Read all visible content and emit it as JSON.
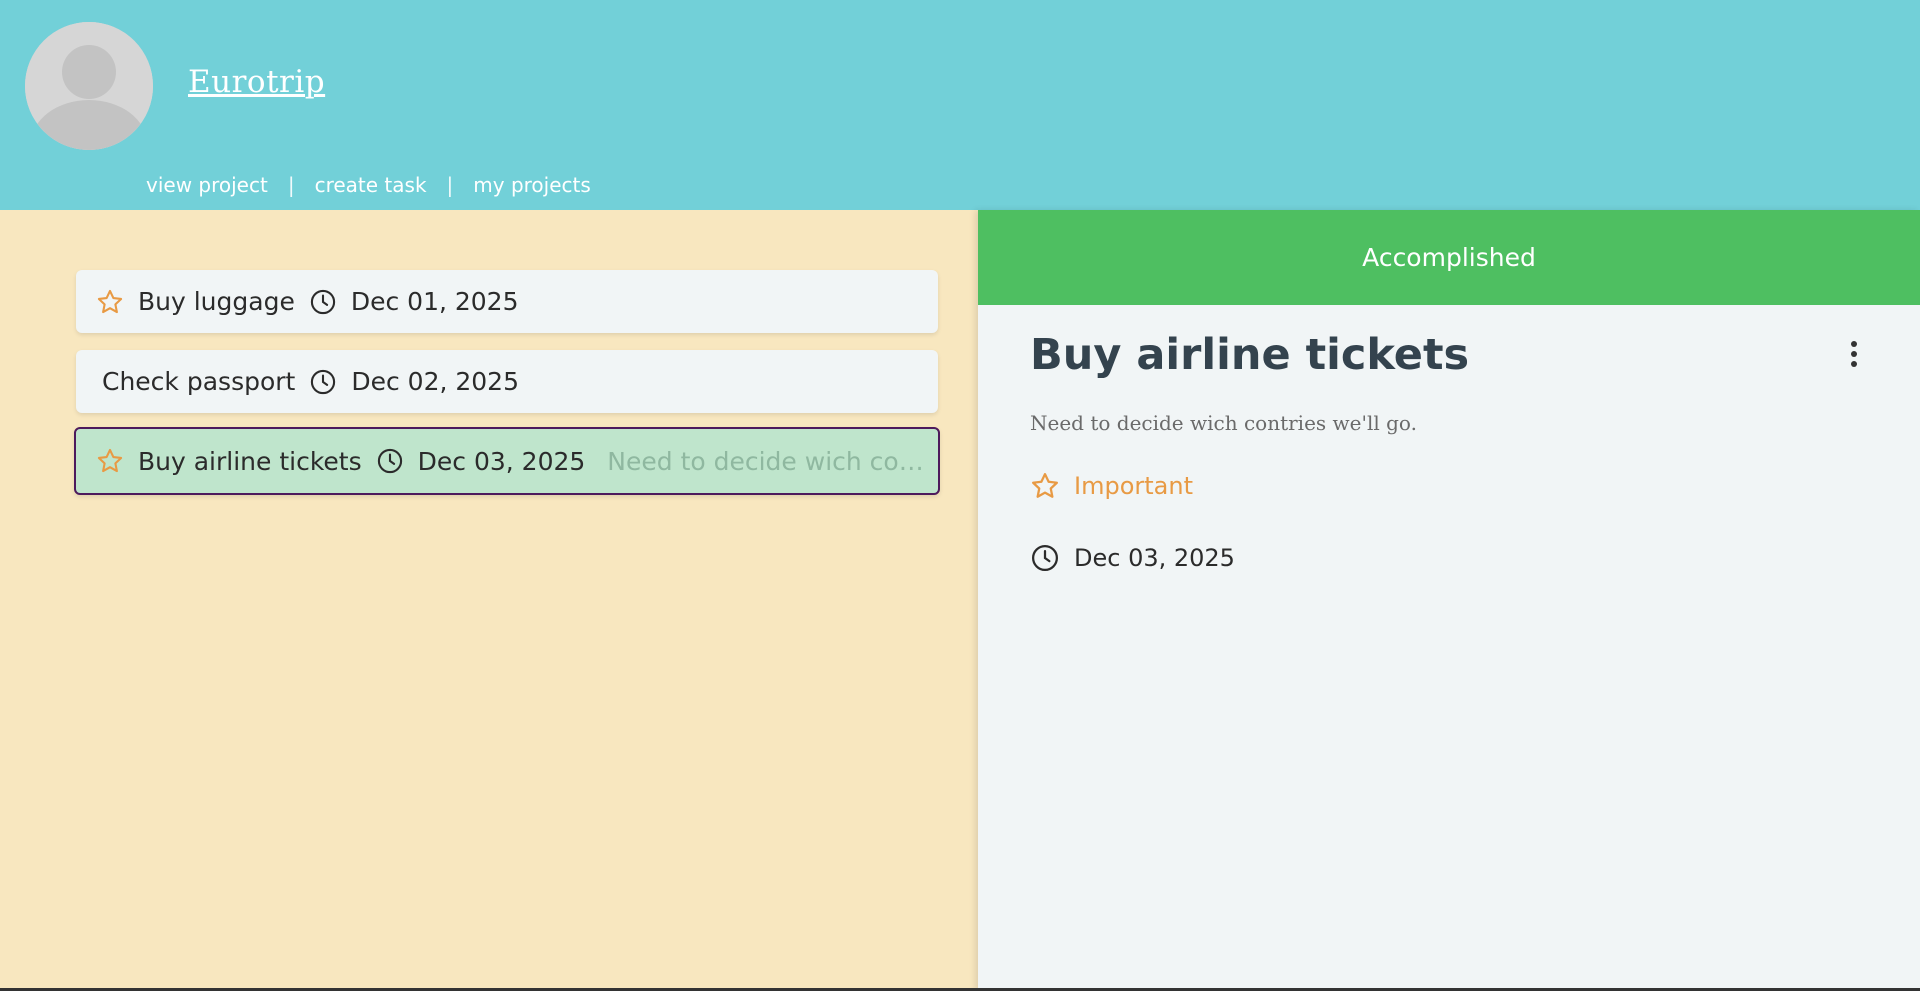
{
  "header": {
    "project_title": "Eurotrip",
    "nav": [
      {
        "label": "view project"
      },
      {
        "label": "create task"
      },
      {
        "label": "my projects"
      }
    ],
    "separator": "|"
  },
  "tasks": [
    {
      "title": "Buy luggage",
      "date": "Dec 01, 2025",
      "important": true,
      "description": ""
    },
    {
      "title": "Check passport",
      "date": "Dec 02, 2025",
      "important": false,
      "description": ""
    },
    {
      "title": "Buy airline tickets",
      "date": "Dec 03, 2025",
      "important": true,
      "description": "Need to decide wich contries ...",
      "selected": true
    }
  ],
  "detail": {
    "status": "Accomplished",
    "title": "Buy airline tickets",
    "description": "Need to decide wich contries we'll go.",
    "priority": "Important",
    "date": "Dec 03, 2025"
  },
  "colors": {
    "header_bg": "#72d0d8",
    "panel_bg": "#f8e7bf",
    "status_green": "#4ebf61",
    "star_orange": "#e89a44",
    "selected_bg": "#bfe5cc",
    "selected_border": "#4d1a5c"
  },
  "icons": {
    "star": "star-outline-icon",
    "clock": "clock-icon",
    "menu": "more-vertical-icon",
    "avatar": "user-silhouette-icon"
  }
}
